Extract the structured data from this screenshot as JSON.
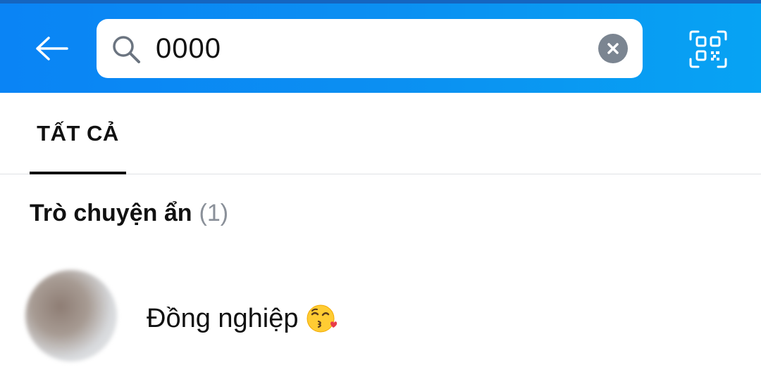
{
  "header": {
    "back_icon": "arrow-left-icon",
    "search": {
      "value": "0000",
      "icon": "search-icon",
      "clear_icon": "close-circle-icon"
    },
    "qr_icon": "qr-scan-icon",
    "colors": {
      "gradient_start": "#0a84f5",
      "gradient_end": "#07a3f3"
    }
  },
  "tabs": [
    {
      "label": "TẤT CẢ",
      "active": true
    }
  ],
  "section": {
    "title": "Trò chuyện ẩn",
    "count": "(1)"
  },
  "results": [
    {
      "name": "Đồng nghiệp",
      "emoji": "kissing-wink-emoji",
      "avatar": "blurred-avatar"
    }
  ]
}
